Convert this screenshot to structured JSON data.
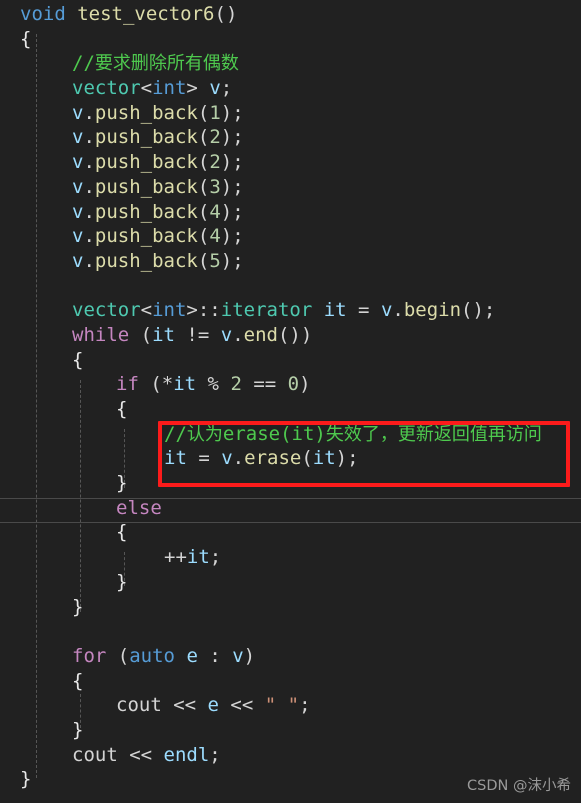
{
  "editor": {
    "background_color": "#212121",
    "font_size_px": 19,
    "line_height_px": 24.7,
    "language": "cpp"
  },
  "code_lines": [
    {
      "id": 1,
      "indent": 0,
      "text": "void test_vector6()"
    },
    {
      "id": 2,
      "indent": 0,
      "text": "{"
    },
    {
      "id": 3,
      "indent": 1,
      "text": "//要求删除所有偶数"
    },
    {
      "id": 4,
      "indent": 1,
      "text": "vector<int> v;"
    },
    {
      "id": 5,
      "indent": 1,
      "text": "v.push_back(1);"
    },
    {
      "id": 6,
      "indent": 1,
      "text": "v.push_back(2);"
    },
    {
      "id": 7,
      "indent": 1,
      "text": "v.push_back(2);"
    },
    {
      "id": 8,
      "indent": 1,
      "text": "v.push_back(3);"
    },
    {
      "id": 9,
      "indent": 1,
      "text": "v.push_back(4);"
    },
    {
      "id": 10,
      "indent": 1,
      "text": "v.push_back(4);"
    },
    {
      "id": 11,
      "indent": 1,
      "text": "v.push_back(5);"
    },
    {
      "id": 12,
      "indent": 1,
      "text": ""
    },
    {
      "id": 13,
      "indent": 1,
      "text": "vector<int>::iterator it = v.begin();"
    },
    {
      "id": 14,
      "indent": 1,
      "text": "while (it != v.end())"
    },
    {
      "id": 15,
      "indent": 1,
      "text": "{"
    },
    {
      "id": 16,
      "indent": 2,
      "text": "if (*it % 2 == 0)"
    },
    {
      "id": 17,
      "indent": 2,
      "text": "{"
    },
    {
      "id": 18,
      "indent": 3,
      "text": "//认为erase(it)失效了，更新返回值再访问"
    },
    {
      "id": 19,
      "indent": 3,
      "text": "it = v.erase(it);"
    },
    {
      "id": 20,
      "indent": 2,
      "text": "}"
    },
    {
      "id": 21,
      "indent": 2,
      "text": "else"
    },
    {
      "id": 22,
      "indent": 2,
      "text": "{"
    },
    {
      "id": 23,
      "indent": 3,
      "text": "++it;"
    },
    {
      "id": 24,
      "indent": 2,
      "text": "}"
    },
    {
      "id": 25,
      "indent": 1,
      "text": "}"
    },
    {
      "id": 26,
      "indent": 1,
      "text": ""
    },
    {
      "id": 27,
      "indent": 1,
      "text": "for (auto e : v)"
    },
    {
      "id": 28,
      "indent": 1,
      "text": "{"
    },
    {
      "id": 29,
      "indent": 2,
      "text": "cout << e << \" \";"
    },
    {
      "id": 30,
      "indent": 1,
      "text": "}"
    },
    {
      "id": 31,
      "indent": 1,
      "text": "cout << endl;"
    },
    {
      "id": 32,
      "indent": 0,
      "text": "}"
    }
  ],
  "annotation": {
    "type": "red-rectangle-highlight",
    "color": "#fc1b1b",
    "border_width_px": 4,
    "covers_lines": [
      18,
      19
    ],
    "comment_text": "//认为erase(it)失效了，更新返回值再访问",
    "code_text": "it = v.erase(it);"
  },
  "current_line": {
    "line_id": 21,
    "text": "else",
    "border_color": "#4a4a4a"
  },
  "watermark": {
    "text": "CSDN @沫小希",
    "color": "#9a9a9a"
  },
  "syntax_colors": {
    "keyword_control": "#c586c0",
    "keyword_type": "#569cd6",
    "class_type": "#4ec9b0",
    "function": "#dcdcaa",
    "variable": "#9cdcfe",
    "number": "#b5cea8",
    "string": "#ce9178",
    "comment": "#4ec94e",
    "plain": "#d4d4d4",
    "background": "#212121"
  }
}
